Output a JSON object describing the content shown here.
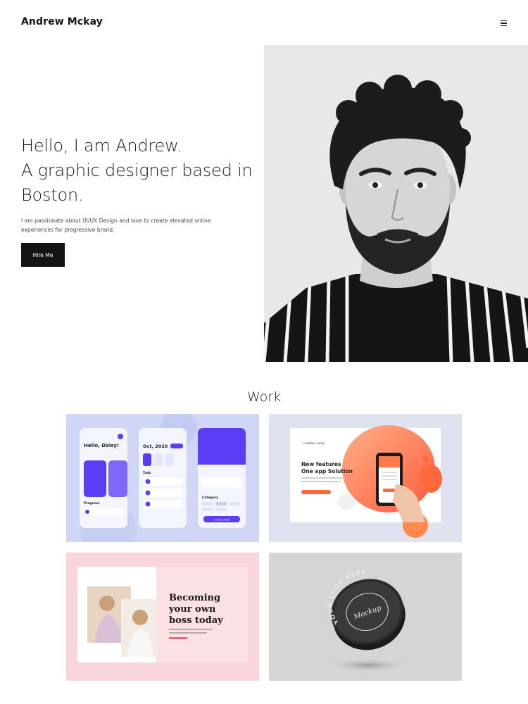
{
  "header": {
    "brand": "Andrew Mckay",
    "menu_icon": "hamburger-icon"
  },
  "hero": {
    "lines": [
      "Hello, I am Andrew.",
      "A graphic designer based in",
      "Boston."
    ],
    "description": "I am passionate about UI/UX Design and love to create elevated online experiences for progressive brand.",
    "cta_label": "Hire Me",
    "portrait_alt": "Black and white portrait of Andrew"
  },
  "work": {
    "title": "Work",
    "projects": [
      {
        "name": "task-app",
        "greeting": "Hello, Daisy!",
        "date": "Oct, 2020",
        "task_heading": "Task",
        "progress_heading": "Progress",
        "category_heading": "Category",
        "create_label": "Create Task"
      },
      {
        "name": "one-app-landing",
        "company": "COMPANY NAME",
        "headline_1": "New features",
        "headline_2": "One app Solution"
      },
      {
        "name": "boss-blog",
        "headline_1": "Becoming",
        "headline_2": "your own",
        "headline_3": "boss today"
      },
      {
        "name": "logo-tin-mockup",
        "ring_text": "YOUR LOGO HERE",
        "center_text": "Mockup"
      }
    ]
  },
  "colors": {
    "accent_purple": "#5b3df5",
    "accent_orange": "#ff6a3d",
    "text_dark": "#141414"
  }
}
